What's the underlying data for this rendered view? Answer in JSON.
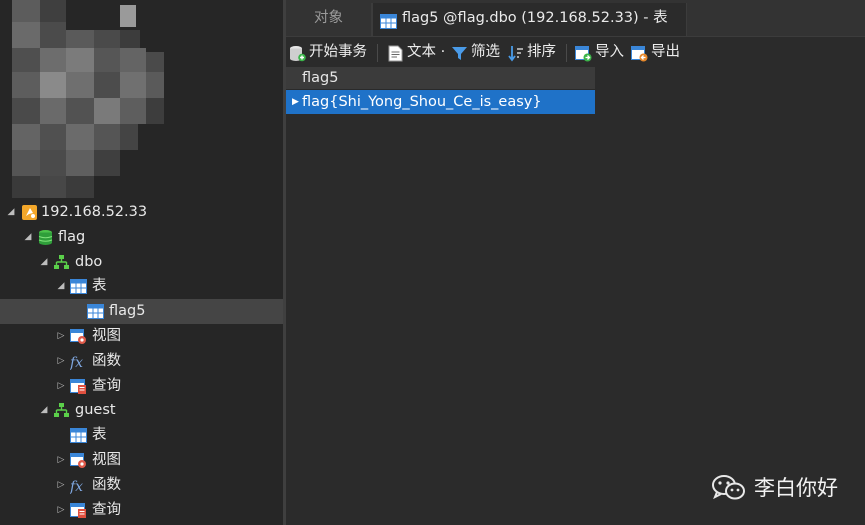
{
  "sidebar": {
    "tree": {
      "server": "192.168.52.33",
      "database": "flag",
      "schema_dbo": "dbo",
      "dbo_tables": "表",
      "table_flag5": "flag5",
      "dbo_views": "视图",
      "dbo_functions": "函数",
      "dbo_queries": "查询",
      "schema_guest": "guest",
      "guest_tables": "表",
      "guest_views": "视图",
      "guest_functions": "函数",
      "guest_queries": "查询"
    }
  },
  "tabs": [
    {
      "label": "对象",
      "active": false
    },
    {
      "label": "flag5 @flag.dbo (192.168.52.33) - 表",
      "active": true
    }
  ],
  "toolbar": {
    "begin_transaction": "开始事务",
    "text": "文本 ·",
    "filter": "筛选",
    "sort": "排序",
    "import": "导入",
    "export": "导出"
  },
  "grid": {
    "columns": [
      "flag5"
    ],
    "rows": [
      [
        "flag{Shi_Yong_Shou_Ce_is_easy}"
      ]
    ]
  },
  "watermark": {
    "text": "李白你好"
  },
  "icons": {
    "server": "server-icon",
    "database": "database-icon",
    "schema": "schema-icon",
    "table": "table-icon",
    "view": "view-icon",
    "function": "function-icon",
    "query": "query-icon",
    "begin_transaction": "transaction-icon",
    "text": "text-icon",
    "filter": "filter-icon",
    "sort": "sort-icon",
    "import": "import-icon",
    "export": "export-icon",
    "watermark": "wechat-icon"
  },
  "colors": {
    "selection": "#1f72c8",
    "panel": "#262626",
    "main_background": "#2b2b2b"
  }
}
